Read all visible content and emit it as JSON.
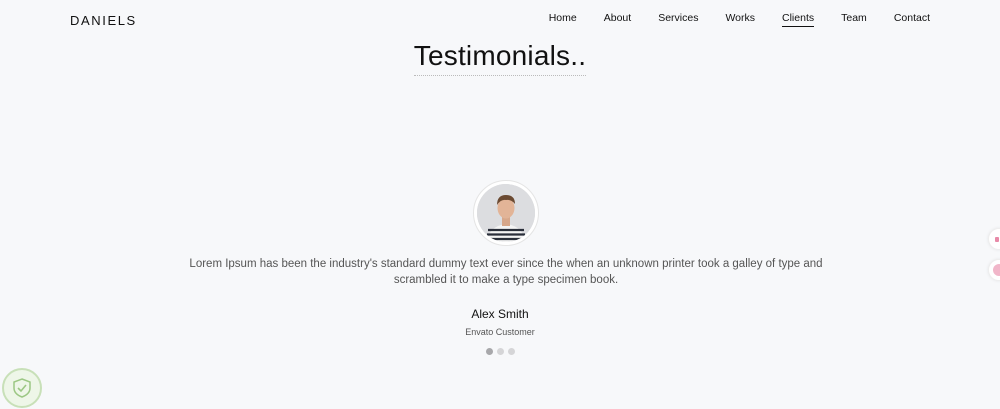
{
  "header": {
    "logo": "DANIELS",
    "nav": [
      {
        "label": "Home"
      },
      {
        "label": "About"
      },
      {
        "label": "Services"
      },
      {
        "label": "Works"
      },
      {
        "label": "Clients",
        "active": true
      },
      {
        "label": "Team"
      },
      {
        "label": "Contact"
      }
    ]
  },
  "section": {
    "title": "Testimonials.."
  },
  "testimonial": {
    "quote": "Lorem Ipsum has been the industry's standard dummy text ever since the when an unknown printer took a galley of type and scrambled it to make a type specimen book.",
    "name": "Alex Smith",
    "role": "Envato Customer",
    "slides_total": 3,
    "active_slide": 1
  },
  "colors": {
    "background": "#f7f8fa",
    "text_dark": "#111111",
    "text_muted": "#555555",
    "dot_active": "#a8a8ab",
    "dot_inactive": "#d5d5d7"
  },
  "icons": {
    "avatar": "person-photo",
    "badge": "shield-check-icon"
  }
}
